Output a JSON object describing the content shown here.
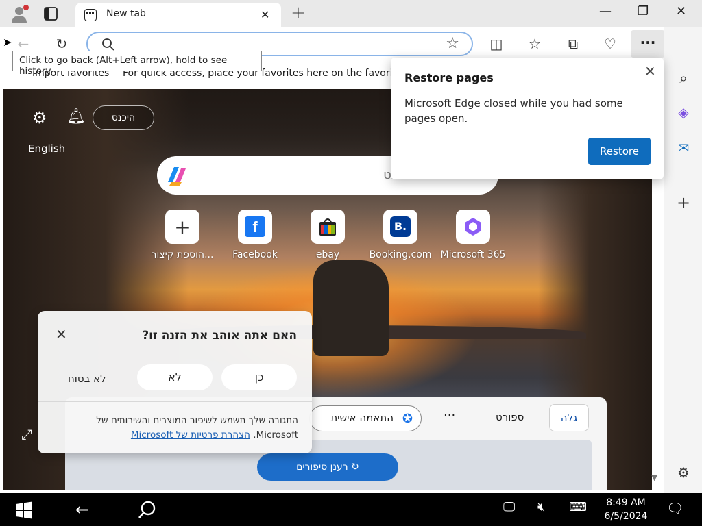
{
  "tab": {
    "title": "New tab",
    "close": "✕"
  },
  "window": {
    "minimize": "—",
    "restore": "❐",
    "close": "✕"
  },
  "newtab_symbol": "+",
  "toolbar": {
    "tooltip": "Click to go back (Alt+Left arrow), hold to see history",
    "more_label": "···",
    "address_value": ""
  },
  "favorites": {
    "import_label": "Import favorites",
    "hint": "For quick access, place your favorites here on the favorite"
  },
  "restore_popup": {
    "title": "Restore pages",
    "message": "Microsoft Edge closed while you had some pages open.",
    "button": "Restore",
    "close": "✕"
  },
  "newtab_page": {
    "signin": "היכנס",
    "language": "English",
    "search_placeholder": "חפש באינטרנט",
    "quick_links": [
      {
        "label": "Microsoft 365",
        "icon": "microsoft-365-icon"
      },
      {
        "label": "Booking.com",
        "icon": "booking-icon"
      },
      {
        "label": "ebay",
        "icon": "ebay-icon"
      },
      {
        "label": "Facebook",
        "icon": "facebook-icon"
      },
      {
        "label": "הוספת קיצור...",
        "icon": "plus-icon"
      }
    ],
    "feed": {
      "tab_discover": "גלה",
      "tab_sport": "ספורט",
      "more": "···",
      "personalize": "התאמה אישית",
      "refresh": "רענן סיפורים"
    }
  },
  "feedback": {
    "question": "האם אתה אוהב את הזנה זו?",
    "yes": "כן",
    "no": "לא",
    "unsure": "לא בטוח",
    "note": "התגובה שלך תשמש לשיפור המוצרים והשירותים של Microsoft.",
    "privacy_link": "הצהרת פרטיות של Microsoft",
    "close": "✕"
  },
  "taskbar": {
    "time": "8:49 AM",
    "date": "6/5/2024"
  },
  "colors": {
    "accent": "#0f6cbd",
    "tab_strip": "#e9e9e9",
    "taskbar": "#000000"
  }
}
